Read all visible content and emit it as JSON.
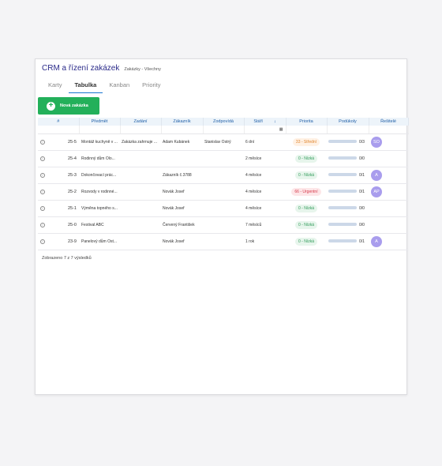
{
  "header": {
    "title": "CRM a řízení zakázek",
    "breadcrumb": "Zakázky - Všechny"
  },
  "tabs": [
    "Karty",
    "Tabulka",
    "Kanban",
    "Priority"
  ],
  "active_tab": "Tabulka",
  "new_button": "Nová zakázka",
  "columns": [
    "#",
    "Předmět",
    "Zadání",
    "Zákazník",
    "Zodpovídá",
    "Stáří",
    "Priorita",
    "Podúkoly",
    "Řešitelé"
  ],
  "rows": [
    {
      "num": "25-5",
      "subject": "Montáž kuchyně v ...",
      "assignment": "Zakázka zahrnuje ...",
      "customer": "Adam Kubánek",
      "responsible": "Stanislav Ostrý",
      "age": "6 dní",
      "priority": "33 - Střední",
      "priority_level": "mid",
      "subtasks": "0/3",
      "subtasks_progress": 0,
      "assignee": "SO"
    },
    {
      "num": "25-4",
      "subject": "Rodinný dům Olo...",
      "assignment": "",
      "customer": "",
      "responsible": "",
      "age": "2 měsíce",
      "priority": "0 - Nízká",
      "priority_level": "low",
      "subtasks": "0/0",
      "subtasks_progress": 0,
      "assignee": ""
    },
    {
      "num": "25-3",
      "subject": "Dokončovací prác...",
      "assignment": "",
      "customer": "Zákazník č.3788",
      "responsible": "",
      "age": "4 měsíce",
      "priority": "0 - Nízká",
      "priority_level": "low",
      "subtasks": "0/1",
      "subtasks_progress": 0,
      "assignee": "A"
    },
    {
      "num": "25-2",
      "subject": "Rozvody v rodinné...",
      "assignment": "",
      "customer": "Novák Josef",
      "responsible": "",
      "age": "4 měsíce",
      "priority": "66 - Urgentní",
      "priority_level": "urg",
      "subtasks": "0/1",
      "subtasks_progress": 0,
      "assignee": "AP"
    },
    {
      "num": "25-1",
      "subject": "Výměna topného s...",
      "assignment": "",
      "customer": "Novák Josef",
      "responsible": "",
      "age": "4 měsíce",
      "priority": "0 - Nízká",
      "priority_level": "low",
      "subtasks": "0/0",
      "subtasks_progress": 0,
      "assignee": ""
    },
    {
      "num": "25-0",
      "subject": "Festival ABC",
      "assignment": "",
      "customer": "Červený František",
      "responsible": "",
      "age": "7 měsíců",
      "priority": "0 - Nízká",
      "priority_level": "low",
      "subtasks": "0/0",
      "subtasks_progress": 0,
      "assignee": ""
    },
    {
      "num": "23-9",
      "subject": "Panelový dům Ost...",
      "assignment": "",
      "customer": "Novák Josef",
      "responsible": "",
      "age": "1 rok",
      "priority": "0 - Nízká",
      "priority_level": "low",
      "subtasks": "0/1",
      "subtasks_progress": 0,
      "assignee": "A"
    }
  ],
  "footer": "Zobrazeno 7 z 7 výsledků",
  "colors": {
    "accent": "#1976d2",
    "new_button": "#23b05a",
    "avatar": "#a99ded"
  }
}
